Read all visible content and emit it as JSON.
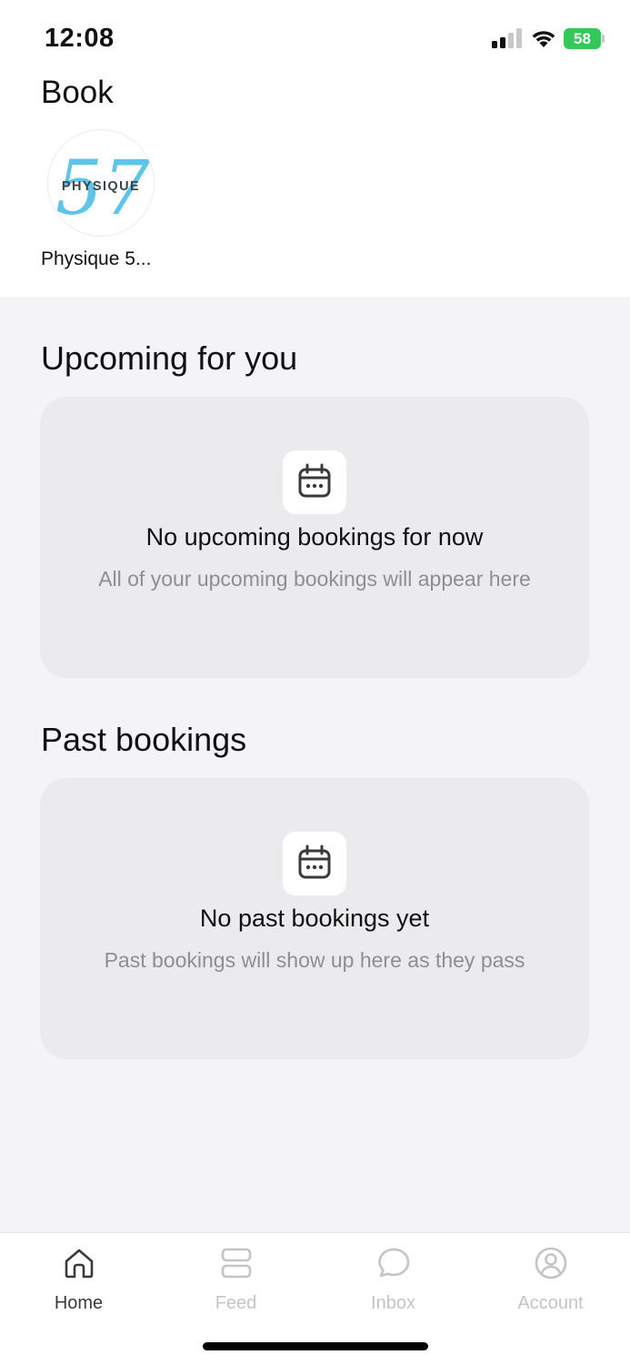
{
  "status_bar": {
    "time": "12:08",
    "battery_level": "58",
    "battery_color": "#34c759"
  },
  "header": {
    "title": "Book"
  },
  "studios": [
    {
      "name": "Physique 5...",
      "logo_text": "PHYSIQUE",
      "logo_number": "57",
      "logo_icon": "physique-57-logo"
    }
  ],
  "upcoming": {
    "section_title": "Upcoming for you",
    "icon": "calendar-icon",
    "empty_title": "No upcoming bookings for now",
    "empty_subtitle": "All of your upcoming bookings will appear here"
  },
  "past": {
    "section_title": "Past bookings",
    "icon": "calendar-icon",
    "empty_title": "No past bookings yet",
    "empty_subtitle": "Past bookings will show up here as they pass"
  },
  "tab_bar": {
    "tabs": [
      {
        "label": "Home",
        "icon": "home-icon",
        "active": true
      },
      {
        "label": "Feed",
        "icon": "feed-icon",
        "active": false
      },
      {
        "label": "Inbox",
        "icon": "chat-bubble-icon",
        "active": false
      },
      {
        "label": "Account",
        "icon": "user-circle-icon",
        "active": false
      }
    ]
  },
  "colors": {
    "accent": "#3a3a3c",
    "inactive": "#c4c4c8",
    "logo_blue": "#5ec4ea"
  }
}
